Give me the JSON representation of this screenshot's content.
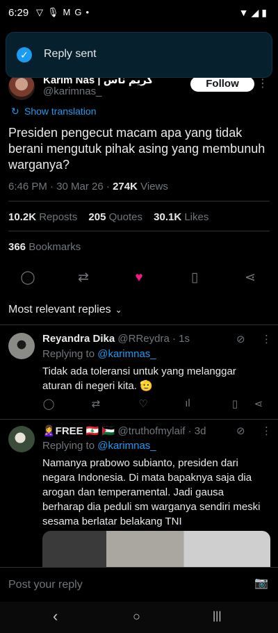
{
  "status_bar": {
    "time": "6:29",
    "left_icons": [
      "vpn-icon",
      "mic-icon",
      "gmail-icon",
      "google-icon",
      "dot-icon"
    ],
    "right_icons": [
      "wifi-icon",
      "signal-icon",
      "battery-icon"
    ]
  },
  "toast": {
    "message": "Reply sent"
  },
  "post": {
    "author_name": "Karim Nas | كريم ناس",
    "author_handle": "@karimnas_",
    "follow_label": "Follow",
    "show_translation": "Show translation",
    "text": "Presiden pengecut macam apa yang tidak berani mengutuk pihak asing yang membunuh warganya?",
    "timestamp": "6:46 PM · 30 Mar 26 · ",
    "views_count": "274K",
    "views_label": " Views",
    "reposts_count": "10.2K",
    "reposts_label": " Reposts",
    "quotes_count": "205",
    "quotes_label": " Quotes",
    "likes_count": "30.1K",
    "likes_label": " Likes",
    "bookmarks_count": "366",
    "bookmarks_label": " Bookmarks"
  },
  "replies_filter": {
    "label": "Most relevant replies"
  },
  "replies": [
    {
      "name": "Reyandra Dika",
      "handle": "@RReydra",
      "time": " · 1s",
      "replying_prefix": "Replying to ",
      "replying_to": "@karimnas_",
      "text": "Tidak ada toleransi untuk yang melanggar aturan di negeri kita. 🫡"
    },
    {
      "name": "🙎‍♀️FREE 🇱🇧 🇵🇸",
      "handle": "@truthofmylaif",
      "time": " · 3d",
      "replying_prefix": "Replying to ",
      "replying_to": "@karimnas_",
      "text": "Namanya prabowo subianto, presiden dari negara Indonesia. Di mata bapaknya saja dia arogan dan temperamental. Jadi gausa berharap dia peduli sm warganya sendiri meski sesama berlatar belakang TNI"
    }
  ],
  "compose": {
    "placeholder": "Post your reply"
  },
  "colors": {
    "accent": "#1d9bf0",
    "like": "#f91880",
    "background": "#000000",
    "muted": "#71767b"
  }
}
